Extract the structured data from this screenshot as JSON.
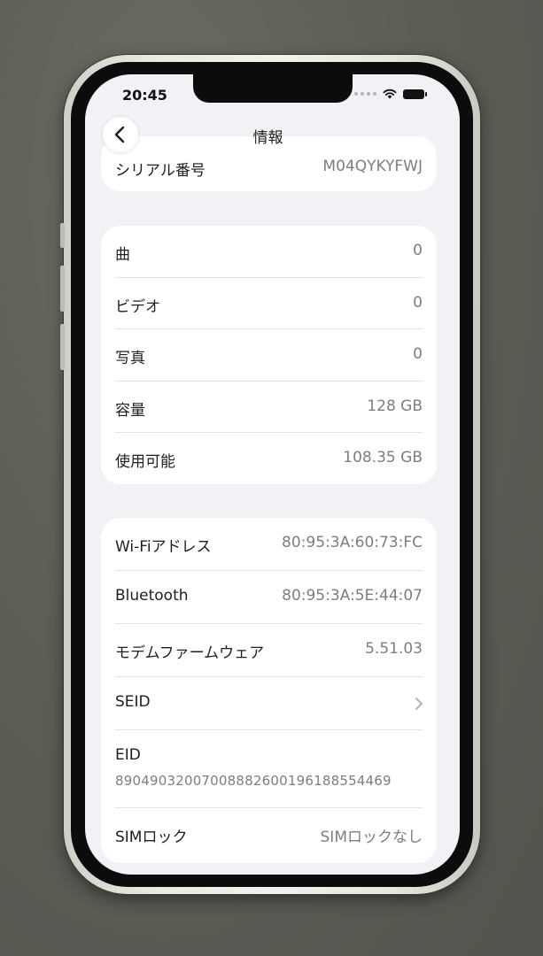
{
  "status": {
    "time": "20:45"
  },
  "nav": {
    "title": "情報"
  },
  "serial": {
    "label": "シリアル番号",
    "value": "M04QYKYFWJ"
  },
  "media": [
    {
      "label": "曲",
      "value": "0"
    },
    {
      "label": "ビデオ",
      "value": "0"
    },
    {
      "label": "写真",
      "value": "0"
    },
    {
      "label": "容量",
      "value": "128 GB"
    },
    {
      "label": "使用可能",
      "value": "108.35 GB"
    }
  ],
  "network": {
    "wifi": {
      "label": "Wi-Fiアドレス",
      "value": "80:95:3A:60:73:FC"
    },
    "bluetooth": {
      "label": "Bluetooth",
      "value": "80:95:3A:5E:44:07"
    },
    "modem": {
      "label": "モデムファームウェア",
      "value": "5.51.03"
    },
    "seid": {
      "label": "SEID"
    },
    "eid": {
      "label": "EID",
      "value": "89049032007008882600196188554469"
    },
    "simlock": {
      "label": "SIMロック",
      "value": "SIMロックなし"
    }
  },
  "icons": {
    "back": "chevron-left-icon",
    "seid_chevron": "chevron-right-icon",
    "wifi": "wifi-icon",
    "battery": "battery-icon"
  }
}
